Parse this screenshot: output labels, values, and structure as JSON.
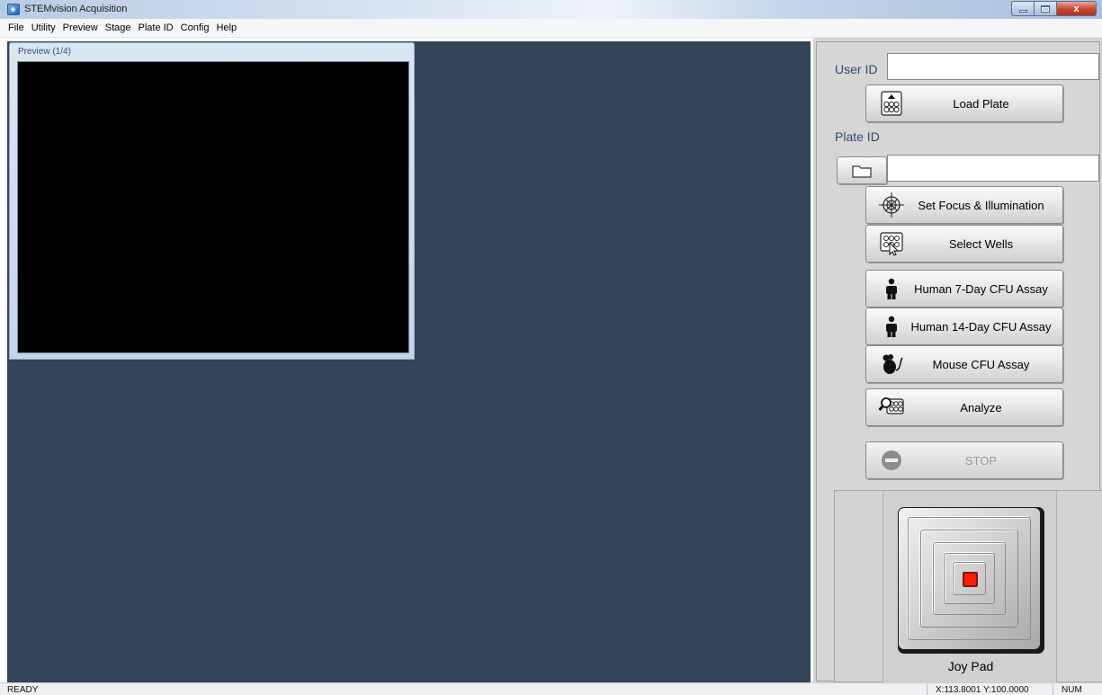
{
  "window": {
    "title": "STEMvision Acquisition",
    "controls": {
      "minimize": "",
      "maximize": "",
      "close": "x"
    }
  },
  "menu": [
    "File",
    "Utility",
    "Preview",
    "Stage",
    "Plate ID",
    "Config",
    "Help"
  ],
  "preview": {
    "title": "Preview (1/4)"
  },
  "panel": {
    "user_id_label": "User ID",
    "user_id_value": "",
    "plate_id_label": "Plate ID",
    "plate_id_value": "",
    "buttons": {
      "load_plate": "Load Plate",
      "set_focus": "Set Focus & Illumination",
      "select_wells": "Select Wells",
      "human_7day": "Human 7-Day CFU Assay",
      "human_14day": "Human 14-Day CFU Assay",
      "mouse_cfu": "Mouse CFU Assay",
      "analyze": "Analyze",
      "stop": "STOP"
    },
    "joypad_label": "Joy Pad"
  },
  "status": {
    "text": "READY",
    "coords": "X:113.8001  Y:100.0000",
    "num": "NUM"
  },
  "colors": {
    "workspace": "#344559",
    "preview_canvas": "#000000",
    "label_blue": "#2e4d73",
    "joypad_center": "#ff1e0c"
  }
}
